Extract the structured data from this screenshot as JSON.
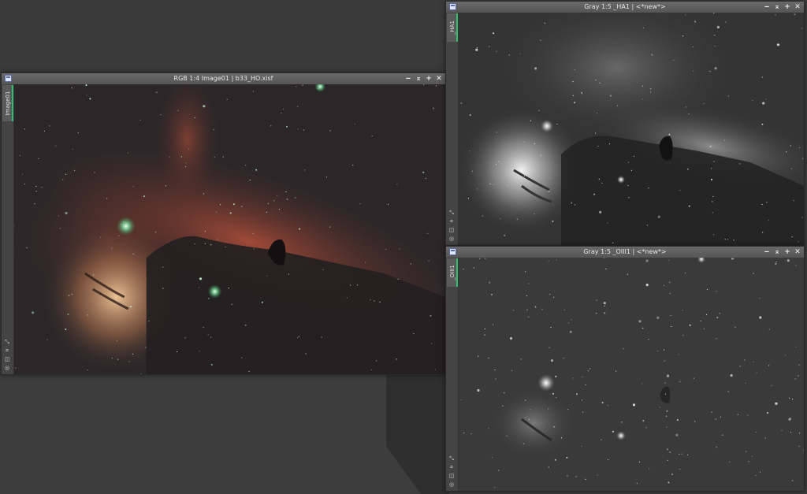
{
  "windows": {
    "rgb": {
      "title": "RGB 1:4 Image01 | b33_HO.xisf",
      "tab": "Image01"
    },
    "ha": {
      "title": "Gray 1:5 _HA1 | <*new*>",
      "tab": "_HA1"
    },
    "oiii": {
      "title": "Gray 1:5 _OIII1 | <*new*>",
      "tab": "_OIII1"
    }
  },
  "controls": {
    "minimize": "‒",
    "shade": "⌅",
    "maximize": "+",
    "close": "✕"
  },
  "icons": [
    "window-menu-icon",
    "minimize-icon",
    "shade-icon",
    "maximize-icon",
    "close-icon",
    "zoom-icon",
    "pan-icon",
    "readout-icon",
    "settings-icon"
  ],
  "colors": {
    "tab_accent": "#2fbf6f",
    "titlebar": "#5e5e5e",
    "workspace": "#3d3d3d"
  }
}
